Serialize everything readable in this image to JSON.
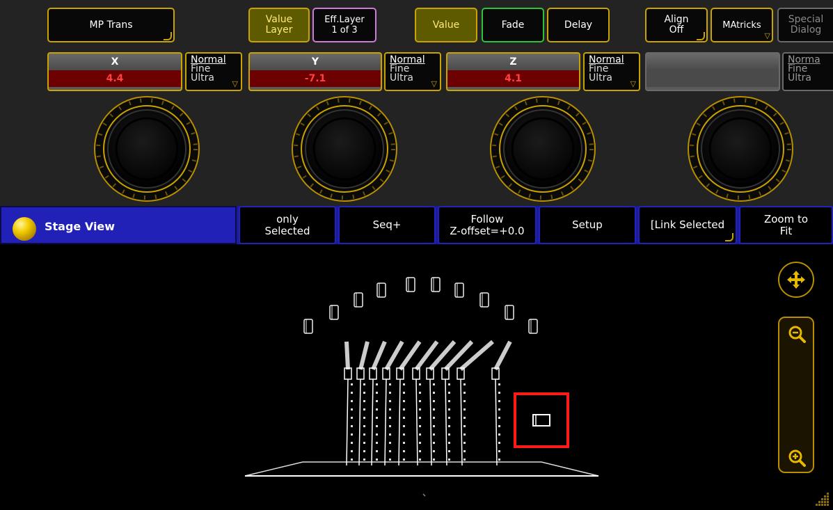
{
  "top_buttons": {
    "mp_trans": "MP Trans",
    "value_layer": "Value\nLayer",
    "eff_layer": "Eff.Layer\n1 of 3",
    "value": "Value",
    "fade": "Fade",
    "delay": "Delay",
    "align": "Align\nOff",
    "matricks": "MAtricks",
    "special_dialog": "Special\nDialog"
  },
  "encoders": [
    {
      "label": "X",
      "value": "4.4",
      "res_normal": "Normal",
      "res_fine": "Fine",
      "res_ultra": "Ultra"
    },
    {
      "label": "Y",
      "value": "-7.1",
      "res_normal": "Normal",
      "res_fine": "Fine",
      "res_ultra": "Ultra"
    },
    {
      "label": "Z",
      "value": "4.1",
      "res_normal": "Normal",
      "res_fine": "Fine",
      "res_ultra": "Ultra"
    },
    {
      "label": "",
      "value": "",
      "res_normal": "Norma",
      "res_fine": "Fine",
      "res_ultra": "Ultra"
    }
  ],
  "title_bar": {
    "title": "Stage View",
    "buttons": [
      "only\nSelected",
      "Seq+",
      "Follow\nZ-offset=+0.0",
      "Setup",
      "[Link Selected",
      "Zoom to\nFit"
    ]
  },
  "colors": {
    "accent_yellow": "#c9a300",
    "title_bar_blue": "#2121b8",
    "value_red": "#ff4040",
    "selection_red": "#ff1a1a"
  },
  "icons": {
    "move": "move-arrows-icon",
    "zoom_out": "zoom-out-icon",
    "zoom_in": "zoom-in-icon"
  }
}
